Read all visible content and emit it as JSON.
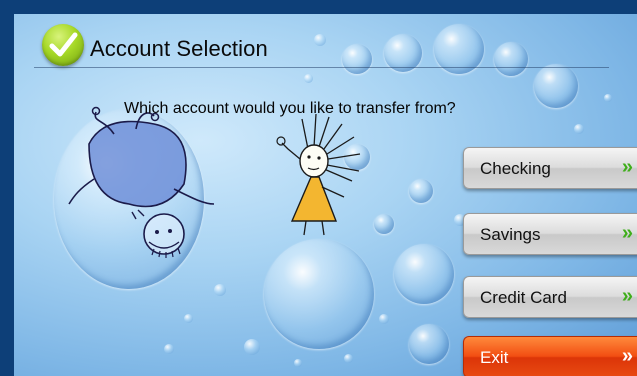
{
  "header": {
    "title": "Account Selection",
    "icon": "checkmark-icon"
  },
  "prompt": {
    "question": "Which account would you like to transfer from?"
  },
  "accounts": {
    "checking": {
      "label": "Checking",
      "chevron": "»"
    },
    "savings": {
      "label": "Savings",
      "chevron": "»"
    },
    "credit_card": {
      "label": "Credit Card",
      "chevron": "»"
    },
    "exit": {
      "label": "Exit",
      "chevron": "»"
    }
  },
  "colors": {
    "accent_green": "#3fae1b",
    "exit_orange": "#f24e12",
    "background_blue": "#a9d4f3"
  }
}
